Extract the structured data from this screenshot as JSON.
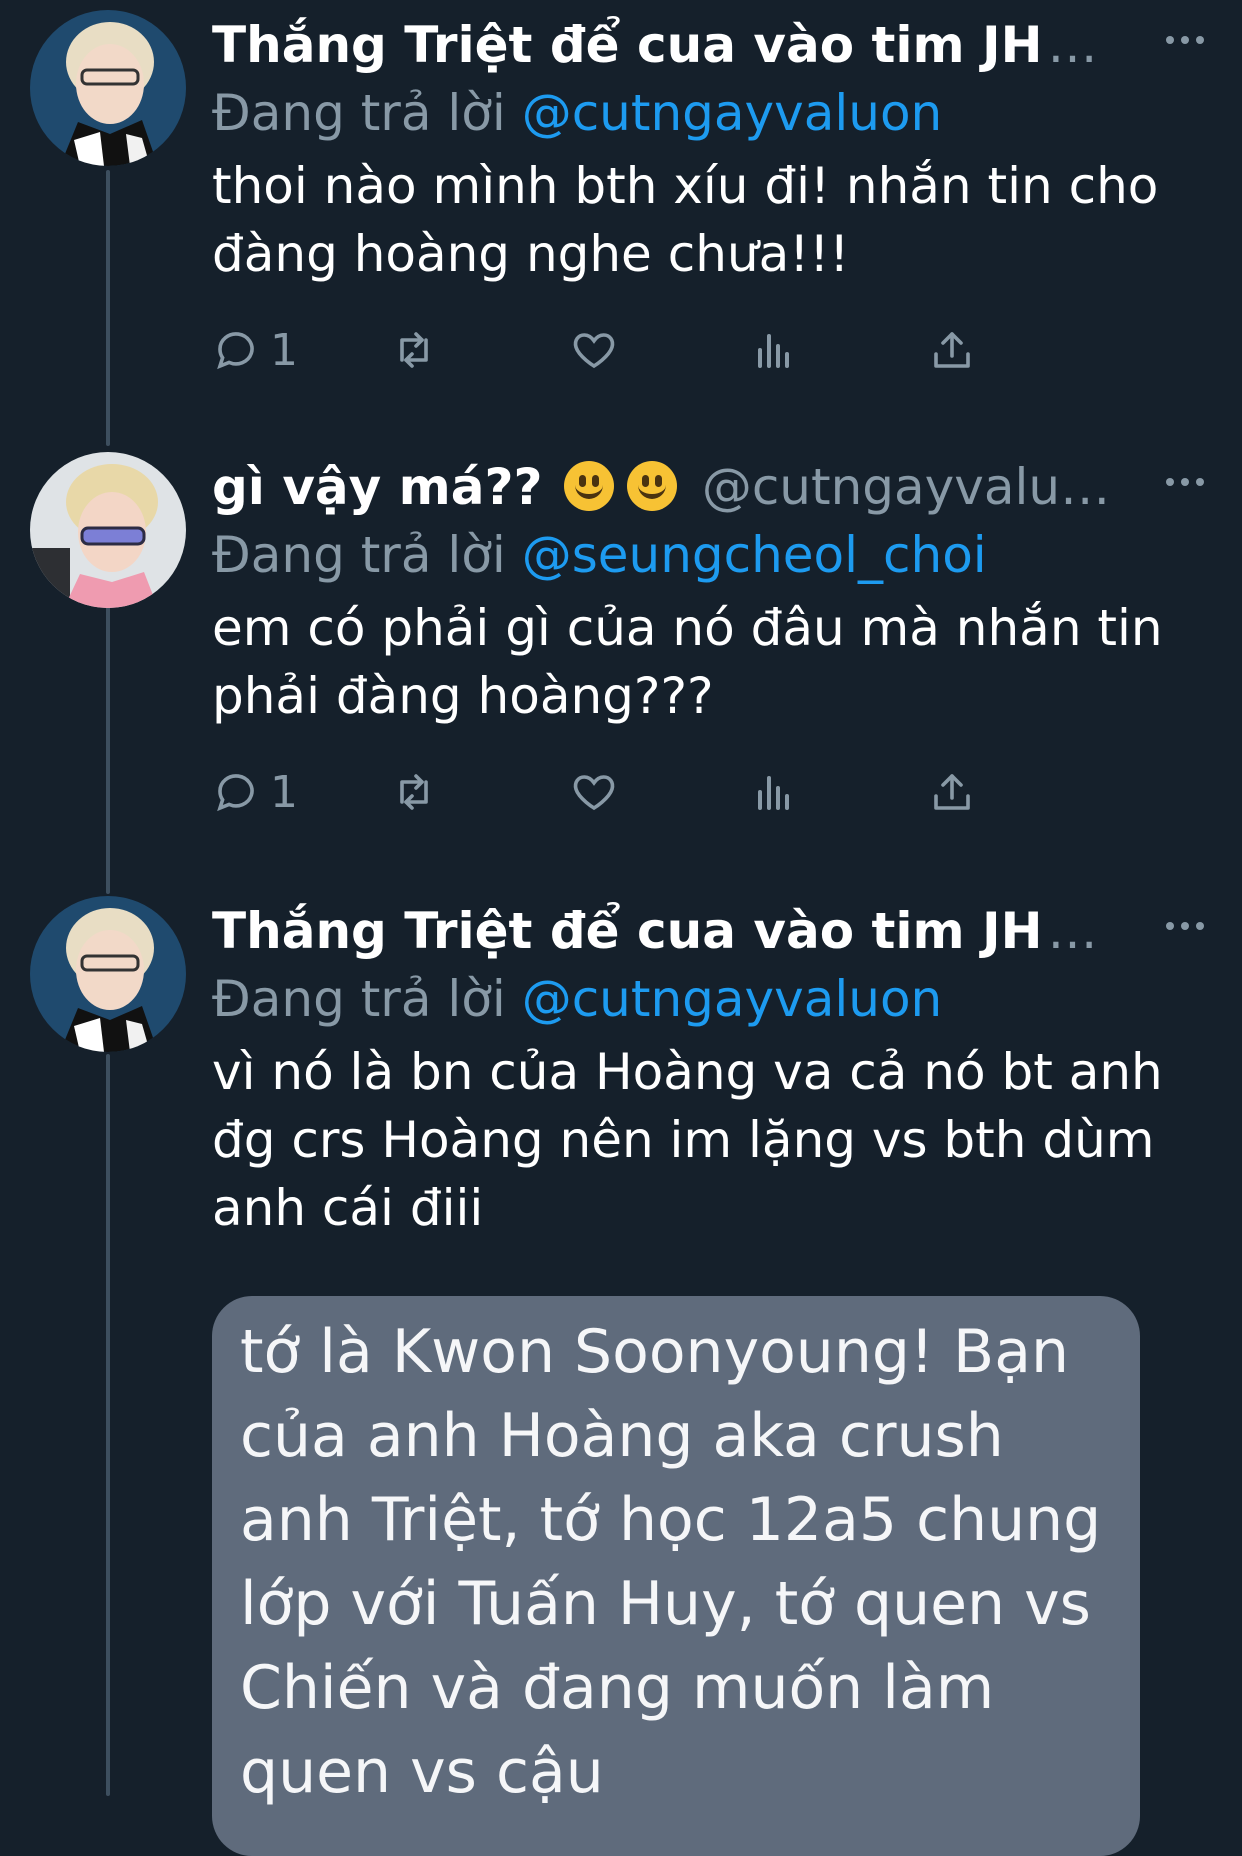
{
  "colors": {
    "background": "#15202b",
    "accent": "#1d9bf0",
    "muted": "#8899a6",
    "card": "#5f6b7c"
  },
  "tweets": [
    {
      "display_name": "Thắng Triệt để cua vào tim JH",
      "replying_prefix": "Đang trả lời",
      "replying_to": "@cutngayvaluon",
      "text": "thoi nào mình bth xíu đi! nhắn tin cho đàng hoàng nghe chưa!!!",
      "reply_count": "1"
    },
    {
      "display_name": "gì vậy má??",
      "handle": "@cutngayvalu…",
      "replying_prefix": "Đang trả lời",
      "replying_to": "@seungcheol_choi",
      "text": "em có phải gì của nó đâu mà nhắn tin phải đàng hoàng???",
      "reply_count": "1"
    },
    {
      "display_name": "Thắng Triệt để cua vào tim JH",
      "replying_prefix": "Đang trả lời",
      "replying_to": "@cutngayvaluon",
      "text": "vì nó là bn của Hoàng va cả nó bt anh đg crs Hoàng nên im lặng vs bth dùm anh cái điii",
      "quoted_text": "tớ là Kwon Soonyoung! Bạn của anh Hoàng aka crush anh Triệt, tớ học 12a5 chung lớp với Tuấn Huy, tớ quen vs Chiến và đang muốn làm quen vs cậu"
    }
  ],
  "icons": {
    "reply": "reply-icon",
    "retweet": "retweet-icon",
    "like": "heart-icon",
    "views": "views-icon",
    "share": "share-icon",
    "more": "more-icon"
  }
}
